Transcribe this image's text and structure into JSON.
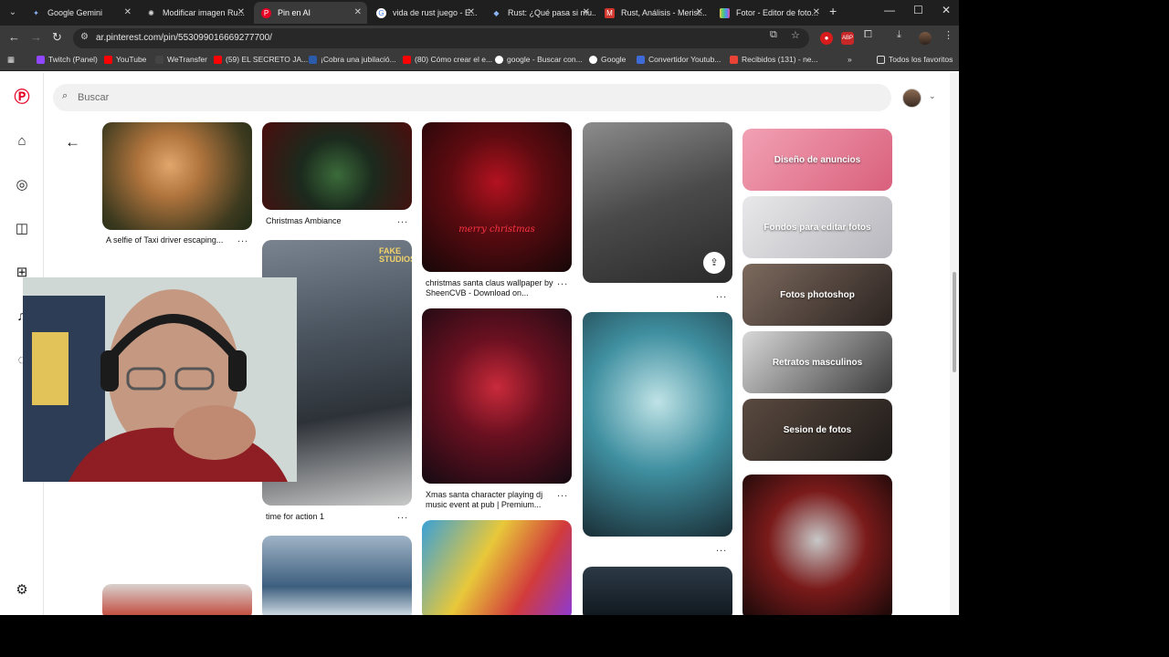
{
  "browser": {
    "tabs": [
      {
        "title": "Google Gemini",
        "active": false
      },
      {
        "title": "Modificar imagen Ru...",
        "active": false
      },
      {
        "title": "Pin en AI",
        "active": true
      },
      {
        "title": "vida de rust juego - E...",
        "active": false
      },
      {
        "title": "Rust: ¿Qué pasa si mu...",
        "active": false
      },
      {
        "title": "Rust, Análisis - Merist...",
        "active": false
      },
      {
        "title": "Fotor - Editor de foto...",
        "active": false
      }
    ],
    "url": "ar.pinterest.com/pin/553099016669277700/",
    "bookmarks": [
      "Twitch (Panel)",
      "YouTube",
      "WeTransfer",
      "(59) EL SECRETO JA...",
      "¡Cobra una jubilació...",
      "(80) Cómo crear el e...",
      "google - Buscar con...",
      "Google",
      "Convertidor Youtub...",
      "Recibidos (131) - ne..."
    ],
    "bookmarks_overflow": "»",
    "all_favorites": "Todos los favoritos"
  },
  "pinterest": {
    "search_placeholder": "Buscar",
    "pins": {
      "taxi_caption": "A selfie of Taxi driver escaping...",
      "christmas_ambiance": "Christmas Ambiance",
      "time_for_action": "time for action 1",
      "santa_wallpaper": "christmas santa claus wallpaper by SheenCVB - Download on...",
      "santa_dj": "Xmas santa character playing dj music event at pub | Premium...",
      "merry_text": "merry christmas",
      "fake_studios": "FAKE STUDIOS",
      "more": "..."
    },
    "categories": [
      "Diseño de anuncios",
      "Fondos para editar fotos",
      "Fotos photoshop",
      "Retratos masculinos",
      "Sesion de fotos"
    ]
  },
  "colors": {
    "pinterest_red": "#e60023",
    "chrome_dark": "#1f1f1f"
  }
}
